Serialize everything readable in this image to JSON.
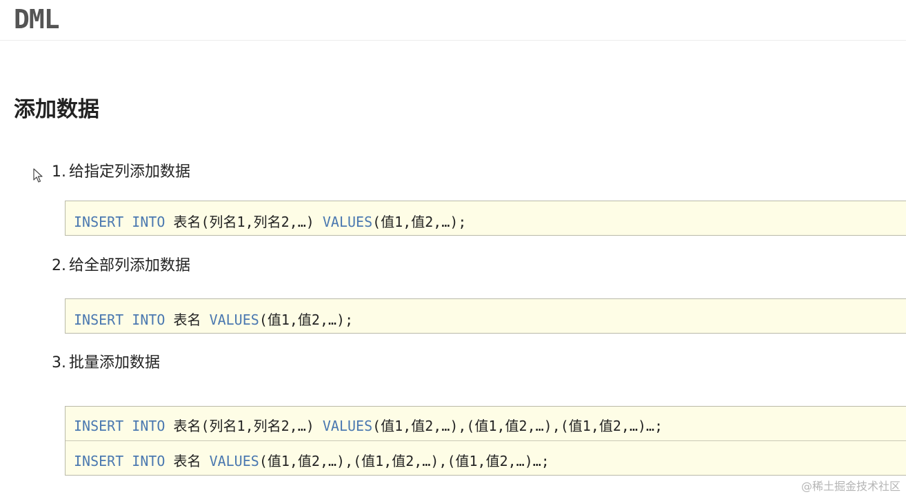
{
  "header": {
    "title": "DML"
  },
  "section": {
    "title": "添加数据"
  },
  "steps": [
    {
      "num": "1.",
      "label": "给指定列添加数据"
    },
    {
      "num": "2.",
      "label": "给全部列添加数据"
    },
    {
      "num": "3.",
      "label": "批量添加数据"
    }
  ],
  "code": {
    "block1": {
      "kw1": "INSERT",
      "kw2": "INTO",
      "t1": "表名(列名1,列名2,…)",
      "kw3": "VALUES",
      "t2": "(值1,值2,…);"
    },
    "block2": {
      "kw1": "INSERT",
      "kw2": "INTO",
      "t1": "表名",
      "kw3": "VALUES",
      "t2": "(值1,值2,…);"
    },
    "block3_line1": {
      "kw1": "INSERT",
      "kw2": "INTO",
      "t1": "表名(列名1,列名2,…)",
      "kw3": "VALUES",
      "t2": "(值1,值2,…),(值1,值2,…),(值1,值2,…)…;"
    },
    "block3_line2": {
      "kw1": "INSERT",
      "kw2": "INTO",
      "t1": "表名",
      "kw3": "VALUES",
      "t2": "(值1,值2,…),(值1,值2,…),(值1,值2,…)…;"
    }
  },
  "watermark": "@稀土掘金技术社区",
  "icons": {
    "cursor": "mouse-pointer-icon"
  }
}
